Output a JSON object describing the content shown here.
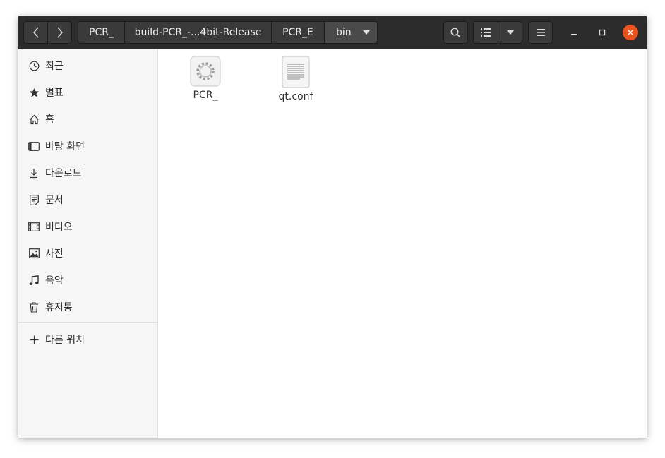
{
  "header": {
    "breadcrumbs": [
      "PCR_",
      "build-PCR_-...4bit-Release",
      "PCR_E",
      "bin"
    ]
  },
  "sidebar": {
    "items": [
      {
        "label": "최근",
        "icon": "clock-icon"
      },
      {
        "label": "별표",
        "icon": "star-icon"
      },
      {
        "label": "홈",
        "icon": "home-icon"
      },
      {
        "label": "바탕 화면",
        "icon": "desktop-icon"
      },
      {
        "label": "다운로드",
        "icon": "download-icon"
      },
      {
        "label": "문서",
        "icon": "document-icon"
      },
      {
        "label": "비디오",
        "icon": "video-icon"
      },
      {
        "label": "사진",
        "icon": "picture-icon"
      },
      {
        "label": "음악",
        "icon": "music-icon"
      },
      {
        "label": "휴지통",
        "icon": "trash-icon"
      }
    ],
    "other_locations": "다른 위치"
  },
  "files": [
    {
      "name": "PCR_",
      "icon": "executable-gear-icon"
    },
    {
      "name": "qt.conf",
      "icon": "text-file-icon"
    }
  ],
  "colors": {
    "header": "#2c2c2c",
    "close": "#e95420",
    "sidebar": "#f6f6f6"
  }
}
